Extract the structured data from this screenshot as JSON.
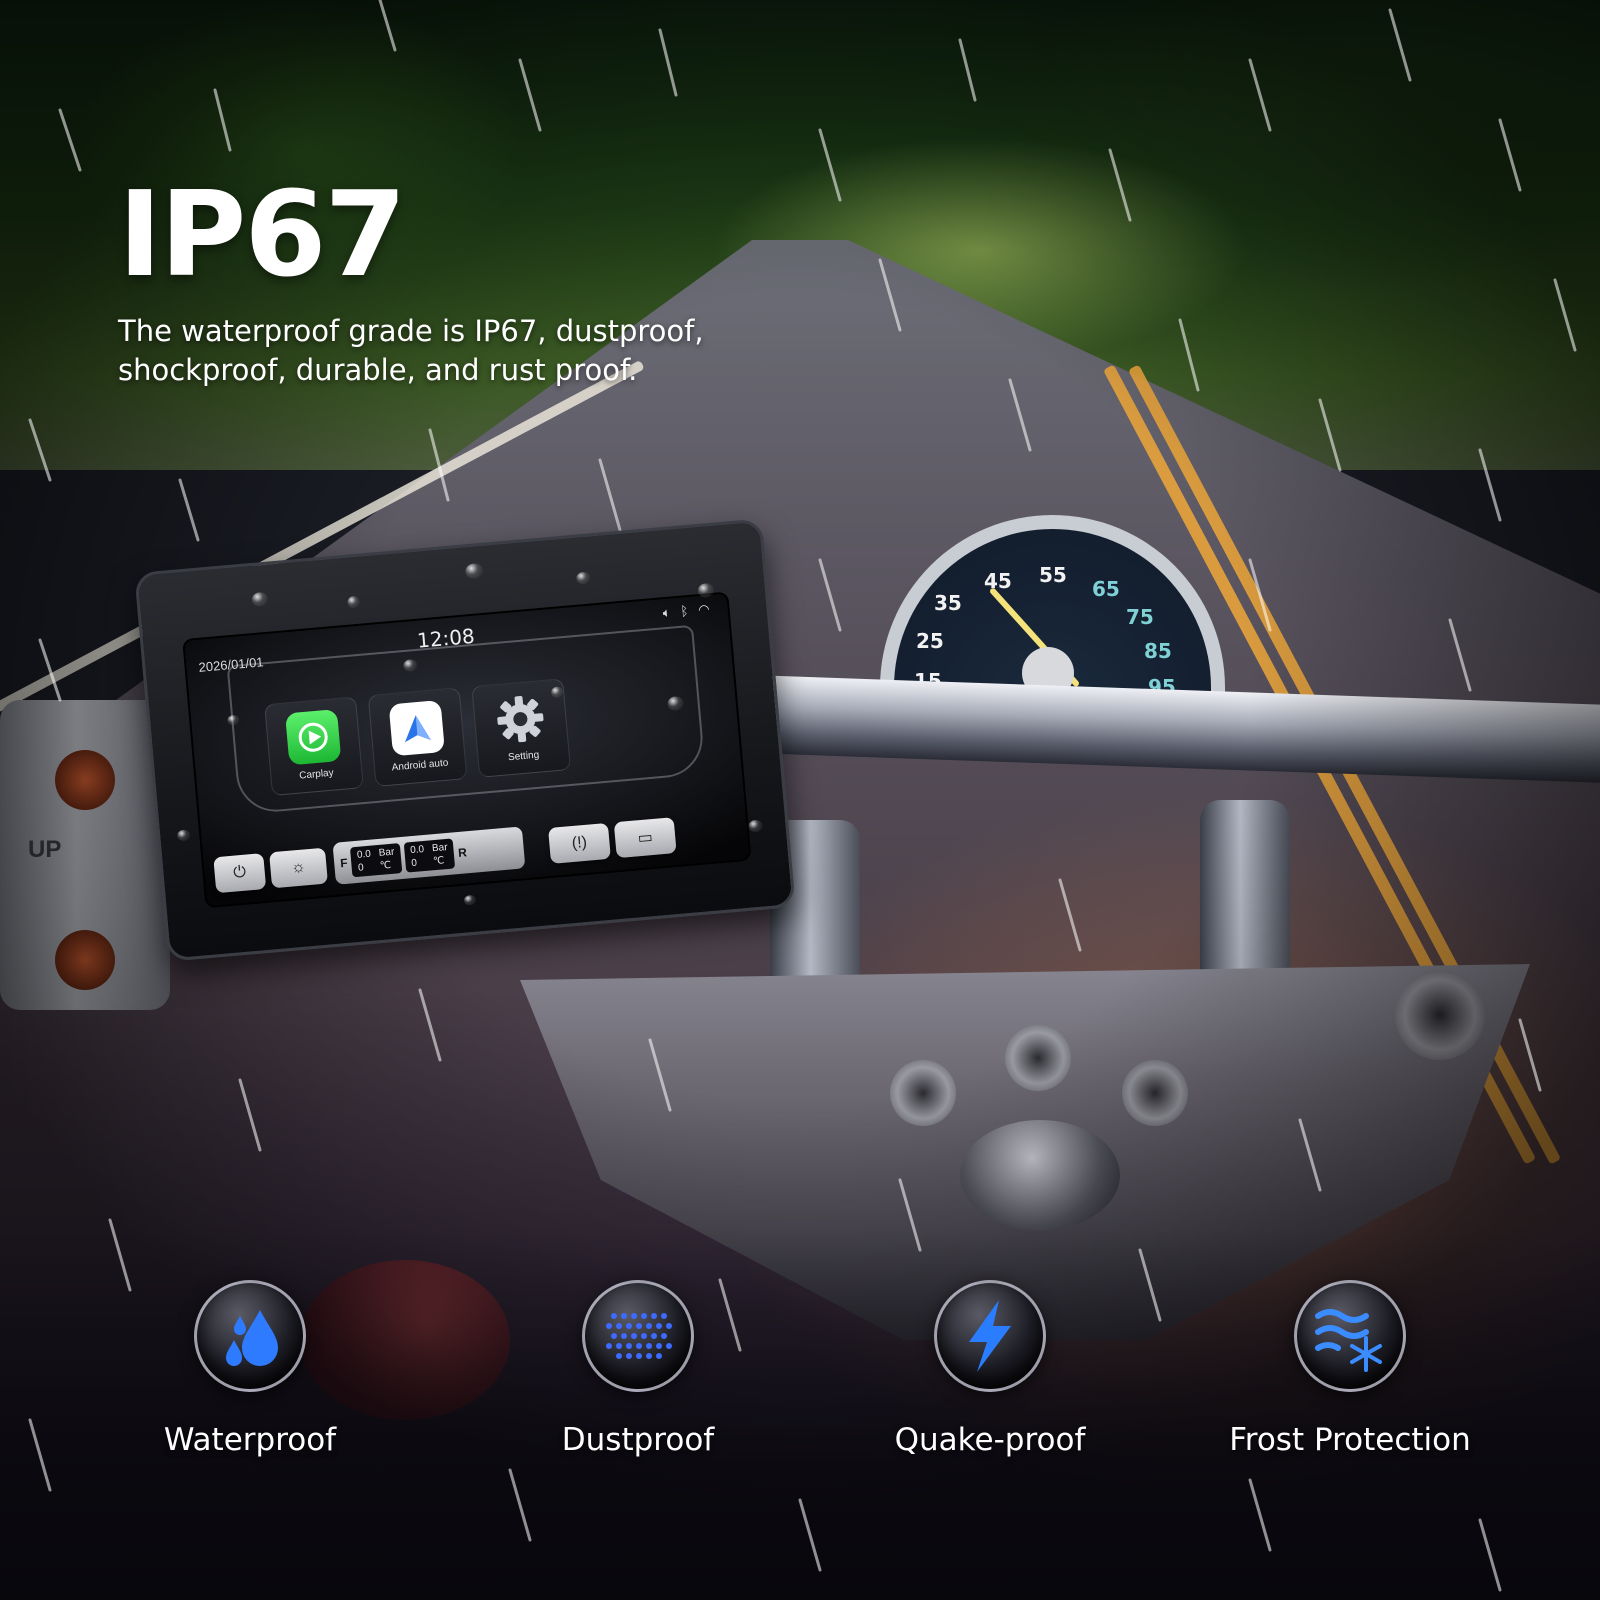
{
  "headline": "IP67",
  "subline": {
    "line1": "The waterproof grade is IP67, dustproof,",
    "line2": "shockproof, durable, and rust proof."
  },
  "device": {
    "date": "2026/01/01",
    "time": "12:08",
    "status_icons": [
      "speaker-icon",
      "bluetooth-icon",
      "wifi-icon"
    ],
    "apps": [
      {
        "label": "Carplay",
        "icon": "carplay-icon"
      },
      {
        "label": "Android auto",
        "icon": "android-auto-icon"
      },
      {
        "label": "Setting",
        "icon": "gear-icon"
      }
    ],
    "tpms": {
      "front": {
        "side": "F",
        "pressure": "0.0",
        "pressure_unit": "Bar",
        "temp": "0",
        "temp_unit": "℃"
      },
      "rear": {
        "side": "R",
        "pressure": "0.0",
        "pressure_unit": "Bar",
        "temp": "0",
        "temp_unit": "℃"
      }
    },
    "buttons": [
      "power-icon",
      "brightness-icon",
      "tire-pressure-icon",
      "screen-mirror-icon"
    ]
  },
  "speedometer": {
    "numbers": [
      "15",
      "25",
      "35",
      "45",
      "55",
      "65",
      "75",
      "85",
      "95"
    ]
  },
  "switch_label": "UP",
  "features": [
    {
      "label": "Waterproof",
      "icon": "water-drops-icon",
      "accent": "#2f7bff"
    },
    {
      "label": "Dustproof",
      "icon": "dust-dots-icon",
      "accent": "#3d6bff"
    },
    {
      "label": "Quake-proof",
      "icon": "lightning-icon",
      "accent": "#2a7dff"
    },
    {
      "label": "Frost Protection",
      "icon": "frost-wind-icon",
      "accent": "#3a8cff"
    }
  ]
}
